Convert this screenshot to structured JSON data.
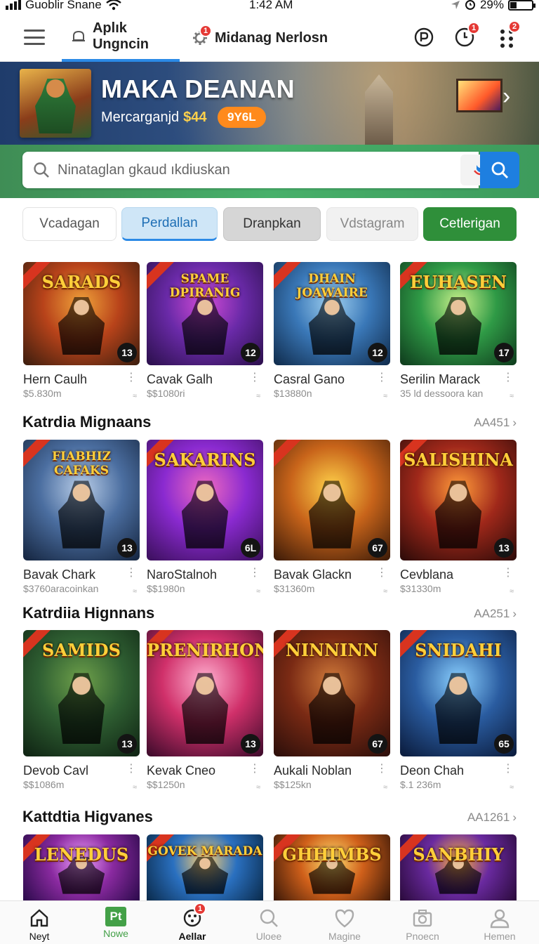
{
  "status": {
    "carrier": "Guoblir Snane",
    "time": "1:42 AM",
    "battery": "29%",
    "battery_level": 0.29
  },
  "nav": {
    "tab_active": "Aplık Ungncin",
    "tab_second": "Midanag Nerlosn",
    "tab_second_badge": "1",
    "icon2_badge": "1",
    "icon3_badge": "2"
  },
  "banner": {
    "title": "MAKA DEANAN",
    "subtitle": "Mercarganjd",
    "price": "$44",
    "pill": "9Y6L"
  },
  "search": {
    "placeholder": "Ninataglan gkaud ıkdiuskan"
  },
  "chips": [
    "Vcadagan",
    "Perdallan",
    "Dranpkan",
    "Vdstagram",
    "Cetlerigan"
  ],
  "sections": [
    {
      "title": "",
      "more": ""
    },
    {
      "title": "Katrdia Mignaans",
      "more": "AA451"
    },
    {
      "title": "Katrdiia Hignnans",
      "more": "AA251"
    },
    {
      "title": "Kattdtia Higvanes",
      "more": "AA1261"
    }
  ],
  "rows": [
    [
      {
        "name": "Hern Caulh",
        "price": "$5.830m",
        "count": "13",
        "art": "SARADS"
      },
      {
        "name": "Cavak Galh",
        "price": "$$1080ri",
        "count": "12",
        "art": "SPAME DPIRANIG"
      },
      {
        "name": "Casral Gano",
        "price": "$13880n",
        "count": "12",
        "art": "DHAIN JOAWAIRE"
      },
      {
        "name": "Serilin Marack",
        "price": "35 ld dessoora kan",
        "count": "17",
        "art": "EUHASEN"
      }
    ],
    [
      {
        "name": "Bavak Chark",
        "price": "$3760aracoinkan",
        "count": "13",
        "art": "FIABHIZ CAFAKS"
      },
      {
        "name": "NaroStalnoh",
        "price": "$$1980n",
        "count": "6L",
        "art": "SAKARINS"
      },
      {
        "name": "Bavak Glackn",
        "price": "$31360m",
        "count": "67",
        "art": ""
      },
      {
        "name": "Cevblana",
        "price": "$31330m",
        "count": "13",
        "art": "SALISHINA"
      }
    ],
    [
      {
        "name": "Devob Cavl",
        "price": "$$1086m",
        "count": "13",
        "art": "SAMIDS"
      },
      {
        "name": "Kevak Cneo",
        "price": "$$1250n",
        "count": "13",
        "art": "PRENIRHONK"
      },
      {
        "name": "Aukali Noblan",
        "price": "$$125kn",
        "count": "67",
        "art": "NINNINN"
      },
      {
        "name": "Deon Chah",
        "price": "$.1 236m",
        "count": "65",
        "art": "SNIDAHI"
      }
    ],
    [
      {
        "name": "",
        "price": "",
        "count": "",
        "art": "LENEDUS"
      },
      {
        "name": "",
        "price": "",
        "count": "",
        "art": "GOVEK MARADA"
      },
      {
        "name": "",
        "price": "",
        "count": "",
        "art": "GHHIMBS"
      },
      {
        "name": "",
        "price": "",
        "count": "",
        "art": "SANBHIY"
      }
    ]
  ],
  "bottom_nav": [
    {
      "label": "Neyt",
      "icon": "home-icon"
    },
    {
      "label": "Nowe",
      "icon": "pt-icon",
      "glyph": "Pt"
    },
    {
      "label": "Aellar",
      "icon": "game-controller-icon",
      "badge": "1"
    },
    {
      "label": "Uloee",
      "icon": "search-icon"
    },
    {
      "label": "Magine",
      "icon": "heart-shield-icon"
    },
    {
      "label": "Pnoecn",
      "icon": "camera-icon"
    },
    {
      "label": "Hemen",
      "icon": "profile-icon"
    }
  ],
  "colors": {
    "accent_blue": "#2b8ae6",
    "search_band_green": "#47b06a",
    "chip_green": "#2f8f3a",
    "badge_red": "#e53935",
    "banner_pill_orange": "#ff8a1c",
    "nav_active_green": "#43a047"
  }
}
